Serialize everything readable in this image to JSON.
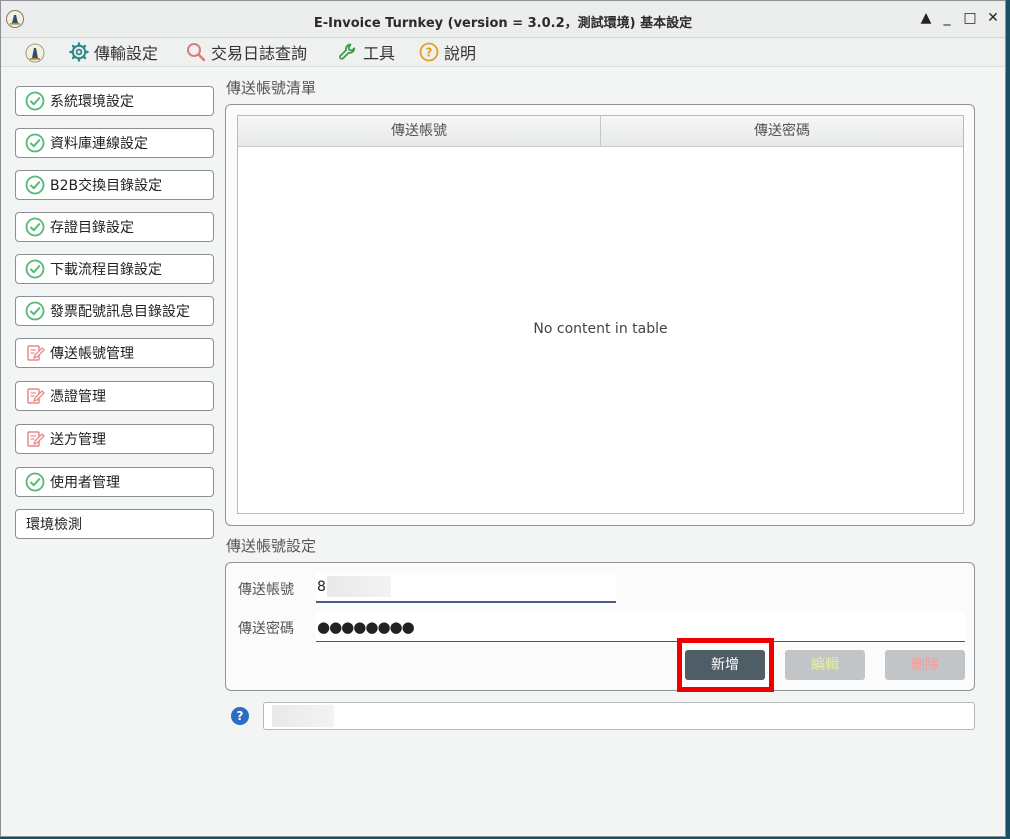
{
  "window": {
    "title": "E-Invoice Turnkey (version = 3.0.2，測試環境) 基本設定",
    "controls": {
      "pin": "▲",
      "minimize": "_",
      "maximize": "□",
      "close": "✕"
    }
  },
  "menu": {
    "items": [
      {
        "label": "傳輸設定",
        "icon": "gear-icon"
      },
      {
        "label": "交易日誌查詢",
        "icon": "search-icon"
      },
      {
        "label": "工具",
        "icon": "wrench-icon"
      },
      {
        "label": "說明",
        "icon": "help-icon"
      }
    ]
  },
  "sidebar": {
    "items": [
      {
        "label": "系統環境設定",
        "status": "done"
      },
      {
        "label": "資料庫連線設定",
        "status": "done"
      },
      {
        "label": "B2B交換目錄設定",
        "status": "done"
      },
      {
        "label": "存證目錄設定",
        "status": "done"
      },
      {
        "label": "下載流程目錄設定",
        "status": "done"
      },
      {
        "label": "發票配號訊息目錄設定",
        "status": "done"
      },
      {
        "label": "傳送帳號管理",
        "status": "edit"
      },
      {
        "label": "憑證管理",
        "status": "edit"
      },
      {
        "label": "送方管理",
        "status": "edit"
      },
      {
        "label": "使用者管理",
        "status": "done"
      },
      {
        "label": "環境檢測",
        "status": "none"
      }
    ]
  },
  "list_section": {
    "title": "傳送帳號清單",
    "columns": [
      "傳送帳號",
      "傳送密碼"
    ],
    "rows": [],
    "empty_text": "No content in table"
  },
  "settings_section": {
    "title": "傳送帳號設定",
    "account_label": "傳送帳號",
    "account_value": "8",
    "password_label": "傳送密碼",
    "password_value": "●●●●●●●●",
    "buttons": {
      "add": "新增",
      "edit": "編輯",
      "delete": "刪除"
    }
  },
  "status_bar": {
    "help_icon": "?",
    "message": ""
  },
  "colors": {
    "check_green": "#55b874",
    "edit_pink": "#e98a8a",
    "highlight_red": "#ee0000",
    "add_button": "#4f5d66"
  }
}
